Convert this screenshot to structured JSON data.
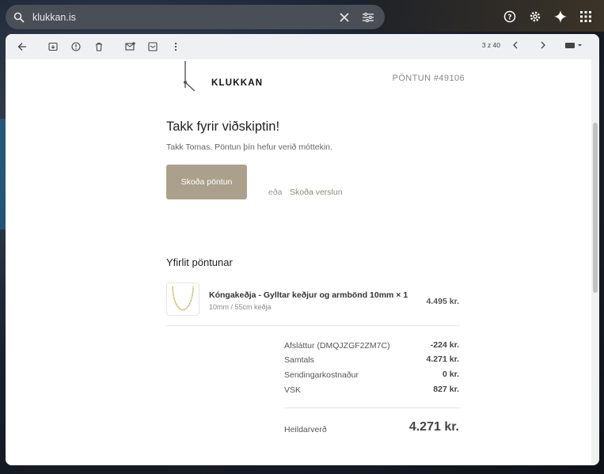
{
  "browser": {
    "url": "klukkan.is"
  },
  "toolbar": {
    "counter": "3 z 40"
  },
  "email": {
    "brand": "KLUKKAN",
    "order_number": "PÖNTUN #49106",
    "headline": "Takk fyrir viðskiptin!",
    "subline": "Takk Tomas. Pöntun þín hefur verið móttekin.",
    "view_order_label": "Skoða pöntun",
    "or_text": "eða",
    "view_shop_label": "Skoða verslun",
    "summary_title": "Yfirlit pöntunar",
    "item": {
      "name": "Kóngakeðja - Gylltar keðjur og armbönd 10mm × 1",
      "variant": "10mm / 55cm keðja",
      "price": "4.495 kr."
    },
    "summary_rows": [
      {
        "label": "Afsláttur (DMQJZGF2ZM7C)",
        "value": "-224 kr."
      },
      {
        "label": "Samtals",
        "value": "4.271 kr."
      },
      {
        "label": "Sendingarkostnaður",
        "value": "0 kr."
      },
      {
        "label": "VSK",
        "value": "827 kr."
      }
    ],
    "total_label": "Heildarverð",
    "total_value": "4.271 kr."
  },
  "colors": {
    "button_bg": "#aba08c",
    "link": "#8f8a7a"
  }
}
